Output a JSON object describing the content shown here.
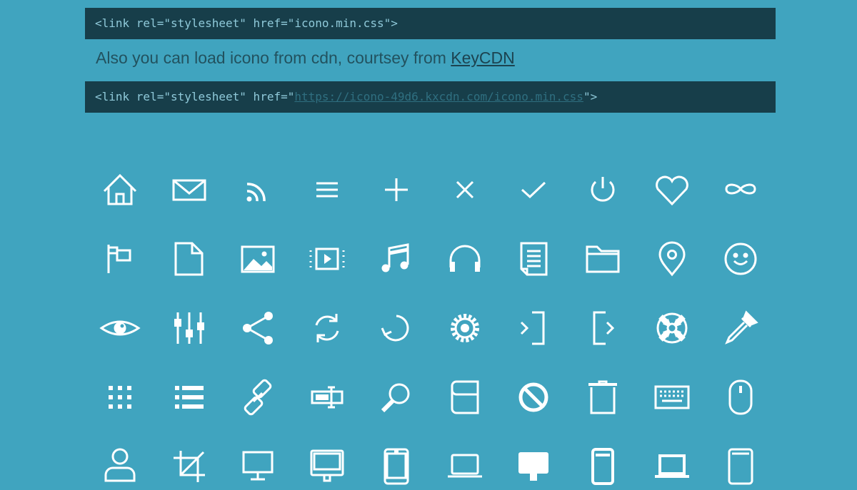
{
  "code_blocks": {
    "local": "<link rel=\"stylesheet\" href=\"icono.min.css\">",
    "cdn_prefix": "<link rel=\"stylesheet\" href=\"",
    "cdn_url": "https://icono-49d6.kxcdn.com/icono.min.css",
    "cdn_suffix": "\">"
  },
  "paragraph": {
    "text": "Also you can load icono from cdn, courtsey from ",
    "link_label": "KeyCDN"
  },
  "colors": {
    "background": "#40a4bf",
    "code_background": "#173e4a",
    "code_text": "#8fc9d9",
    "icon": "#ffffff"
  },
  "icons": [
    [
      "home-icon",
      "mail-icon",
      "rss-icon",
      "hamburger-icon",
      "plus-icon",
      "cross-icon",
      "check-icon",
      "power-icon",
      "heart-icon",
      "infinity-icon"
    ],
    [
      "flag-icon",
      "document-icon",
      "image-icon",
      "video-icon",
      "music-icon",
      "headphones-icon",
      "file-icon",
      "folder-icon",
      "location-icon",
      "smile-icon"
    ],
    [
      "eye-icon",
      "sliders-icon",
      "share-icon",
      "sync-icon",
      "reset-icon",
      "gear-icon",
      "sign-in-icon",
      "sign-out-icon",
      "support-icon",
      "dropper-icon"
    ],
    [
      "tiles-icon",
      "list-icon",
      "chain-icon",
      "textbox-icon",
      "search-icon",
      "book-icon",
      "forbidden-icon",
      "trash-icon",
      "keyboard-icon",
      "mouse-icon"
    ],
    [
      "user-icon",
      "crop-icon",
      "display-icon",
      "imac-icon",
      "iphone-icon",
      "macbook-icon",
      "imac-bold-icon",
      "iphone-bold-icon",
      "macbook-bold-icon",
      "ipad-icon"
    ]
  ]
}
